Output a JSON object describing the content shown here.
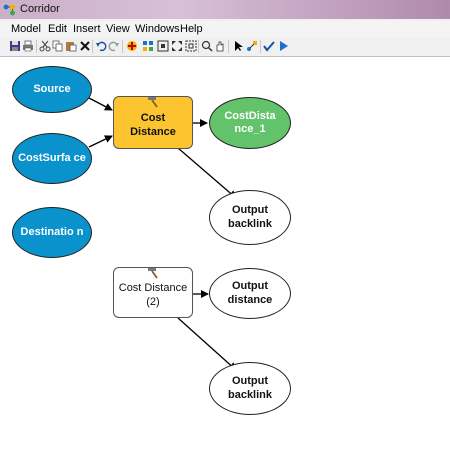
{
  "window": {
    "title": "Corridor"
  },
  "menu": [
    "Model",
    "Edit",
    "Insert",
    "View",
    "Windows",
    "Help"
  ],
  "toolbar_icons": [
    "save-icon",
    "print-icon",
    "cut-icon",
    "copy-icon",
    "paste-icon",
    "delete-icon",
    "undo-icon",
    "redo-icon",
    "add-data-icon",
    "auto-layout-icon",
    "full-extent-icon",
    "fit-icon",
    "zoom-in-icon",
    "zoom-out-icon",
    "zoom-icon",
    "pan-icon",
    "select-icon",
    "connect-icon",
    "validate-icon",
    "run-icon"
  ],
  "nodes": {
    "source": "Source",
    "costsurface": "CostSurfa ce",
    "destination": "Destinatio n",
    "cost_distance": "Cost Distance",
    "costdistance_1": "CostDista nce_1",
    "output_backlink_1": "Output backlink",
    "cost_distance_2": "Cost Distance (2)",
    "output_distance": "Output distance",
    "output_backlink_2": "Output backlink"
  },
  "colors": {
    "input": "#0a92cc",
    "tool_active": "#fcc42f",
    "output_derived": "#62c36a",
    "output_empty": "#ffffff"
  }
}
